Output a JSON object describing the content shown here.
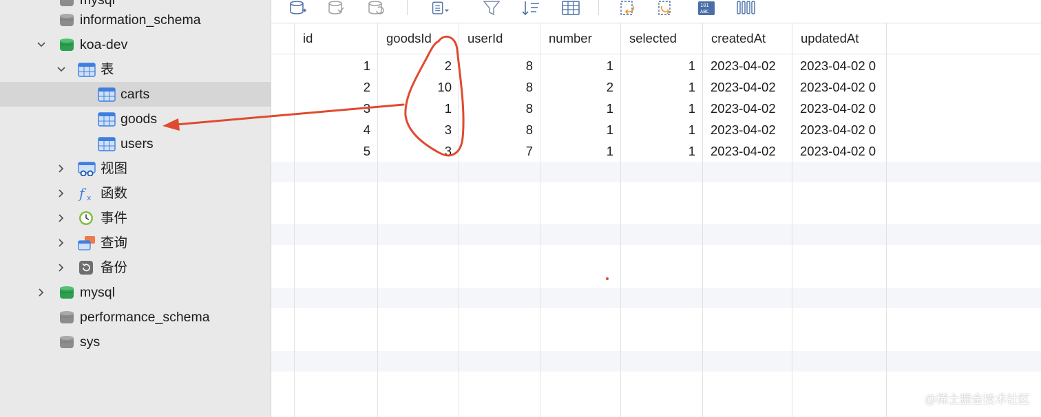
{
  "sidebar": {
    "items": [
      {
        "label": "information_schema",
        "type": "database",
        "color": "gray"
      },
      {
        "label": "koa-dev",
        "type": "database",
        "color": "green",
        "expanded": true
      },
      {
        "label": "表",
        "type": "tables-folder",
        "expanded": true
      },
      {
        "label": "carts",
        "type": "table",
        "selected": true
      },
      {
        "label": "goods",
        "type": "table"
      },
      {
        "label": "users",
        "type": "table"
      },
      {
        "label": "视图",
        "type": "views-folder"
      },
      {
        "label": "函数",
        "type": "functions-folder"
      },
      {
        "label": "事件",
        "type": "events-folder"
      },
      {
        "label": "查询",
        "type": "queries-folder"
      },
      {
        "label": "备份",
        "type": "backups-folder"
      },
      {
        "label": "mysql",
        "type": "database",
        "color": "green"
      },
      {
        "label": "performance_schema",
        "type": "database",
        "color": "gray"
      },
      {
        "label": "sys",
        "type": "database",
        "color": "gray"
      }
    ]
  },
  "toolbar": {
    "icons": [
      "import-icon",
      "export-icon",
      "refresh-icon",
      "page-icon",
      "filter-icon",
      "sort-icon",
      "grid-icon",
      "undo-icon",
      "redo-icon",
      "text-binary-icon",
      "columns-icon"
    ]
  },
  "table": {
    "columns": [
      "id",
      "goodsId",
      "userId",
      "number",
      "selected",
      "createdAt",
      "updatedAt"
    ],
    "rows": [
      [
        "1",
        "2",
        "8",
        "1",
        "1",
        "2023-04-02",
        "2023-04-02 0"
      ],
      [
        "2",
        "10",
        "8",
        "2",
        "1",
        "2023-04-02",
        "2023-04-02 0"
      ],
      [
        "3",
        "1",
        "8",
        "1",
        "1",
        "2023-04-02",
        "2023-04-02 0"
      ],
      [
        "4",
        "3",
        "8",
        "1",
        "1",
        "2023-04-02",
        "2023-04-02 0"
      ],
      [
        "5",
        "3",
        "7",
        "1",
        "1",
        "2023-04-02",
        "2023-04-02 0"
      ]
    ]
  },
  "annotation": {
    "color": "#e04a2f"
  },
  "watermark": "@稀土掘金技术社区",
  "colors": {
    "sidebar_bg": "#e9e9e9",
    "selected_row": "#d6d6d6",
    "table_icon": "#3f7fe0",
    "db_green": "#2e9e4f",
    "db_gray": "#8c8c8c"
  }
}
